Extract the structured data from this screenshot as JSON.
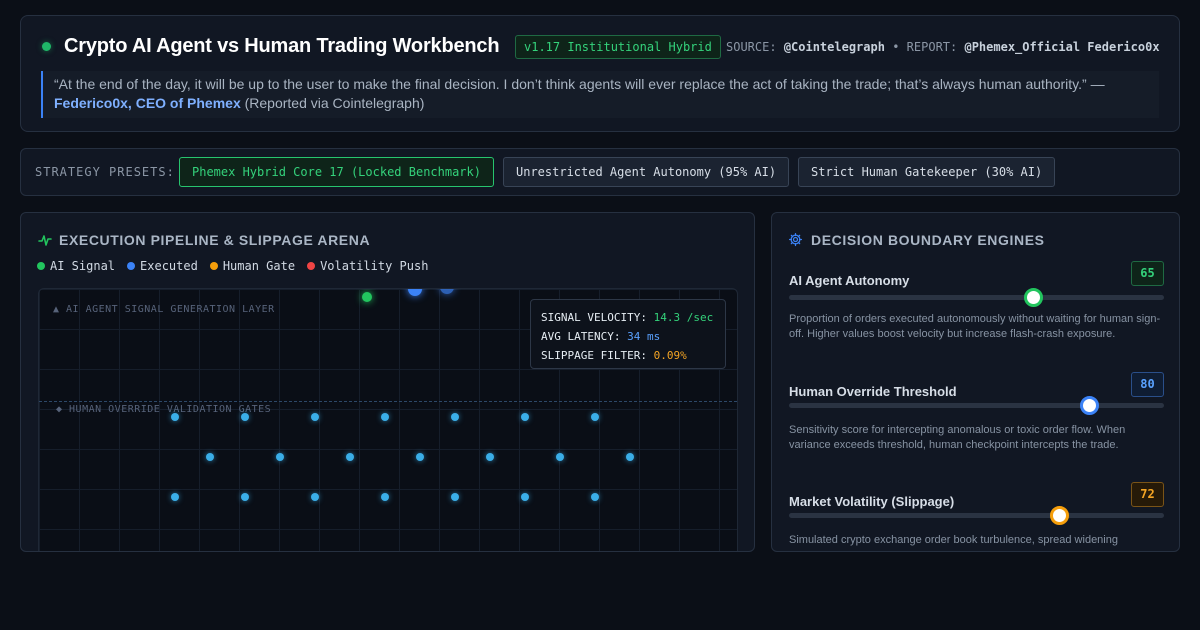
{
  "header": {
    "title": "Crypto AI Agent vs Human Trading Workbench",
    "version": "v1.17 Institutional Hybrid",
    "source_label": "SOURCE:",
    "source_value": "@Cointelegraph",
    "separator": "•",
    "report_label": "REPORT:",
    "report_value": "@Phemex_Official Federico0x",
    "quote_text": "“At the end of the day, it will be up to the user to make the final decision. I don’t think agents will ever replace the act of taking the trade; that’s always human authority.” —",
    "quote_author": "Federico0x, CEO of Phemex",
    "quote_suffix": "(Reported via Cointelegraph)"
  },
  "presets": {
    "label": "STRATEGY PRESETS:",
    "items": [
      {
        "label": "Phemex Hybrid Core 17 (Locked Benchmark)",
        "active": true
      },
      {
        "label": "Unrestricted Agent Autonomy (95% AI)",
        "active": false
      },
      {
        "label": "Strict Human Gatekeeper (30% AI)",
        "active": false
      }
    ]
  },
  "pipeline": {
    "title": "EXECUTION PIPELINE & SLIPPAGE ARENA",
    "legend": [
      {
        "label": "AI Signal",
        "color": "#22c55e"
      },
      {
        "label": "Executed",
        "color": "#3b82f6"
      },
      {
        "label": "Human Gate",
        "color": "#f59e0b"
      },
      {
        "label": "Volatility Push",
        "color": "#ef4444"
      }
    ],
    "layer_ai": "▲ AI AGENT SIGNAL GENERATION LAYER",
    "layer_human": "◆ HUMAN OVERRIDE VALIDATION GATES",
    "metrics": {
      "velocity_label": "SIGNAL VELOCITY:",
      "velocity_value": "14.3 /sec",
      "latency_label": "AVG LATENCY:",
      "latency_value": "34 ms",
      "slippage_label": "SLIPPAGE FILTER:",
      "slippage_value": "0.09%"
    }
  },
  "engines": {
    "title": "DECISION BOUNDARY ENGINES",
    "items": [
      {
        "name": "AI Agent Autonomy",
        "value": "65",
        "level": 0.65,
        "color": "#22c55e",
        "desc": "Proportion of orders executed autonomously without waiting for human sign-off. Higher values boost velocity but increase flash-crash exposure."
      },
      {
        "name": "Human Override Threshold",
        "value": "80",
        "level": 0.8,
        "color": "#3b82f6",
        "desc": "Sensitivity score for intercepting anomalous or toxic order flow. When variance exceeds threshold, human checkpoint intercepts the trade."
      },
      {
        "name": "Market Volatility (Slippage)",
        "value": "72",
        "level": 0.72,
        "color": "#f59e0b",
        "desc": "Simulated crypto exchange order book turbulence, spread widening"
      }
    ]
  }
}
